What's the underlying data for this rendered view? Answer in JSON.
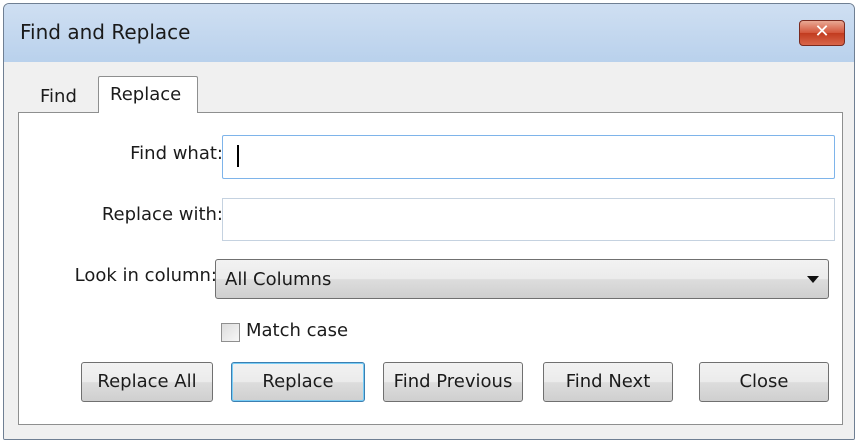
{
  "window": {
    "title": "Find and Replace",
    "close_symbol": "✕"
  },
  "tabs": [
    {
      "label": "Find",
      "active": false
    },
    {
      "label": "Replace",
      "active": true
    }
  ],
  "form": {
    "find_what": {
      "label": "Find what:",
      "value": ""
    },
    "replace_with": {
      "label": "Replace with:",
      "value": ""
    },
    "look_in_column": {
      "label": "Look in column:",
      "selected": "All Columns"
    },
    "match_case": {
      "label": "Match case",
      "checked": false
    }
  },
  "buttons": {
    "replace_all": "Replace All",
    "replace": "Replace",
    "find_previous": "Find Previous",
    "find_next": "Find Next",
    "close": "Close"
  },
  "colors": {
    "titlebar": "#c4d8ef",
    "close_button": "#d3553a",
    "focus_border": "#3c7fb1"
  }
}
